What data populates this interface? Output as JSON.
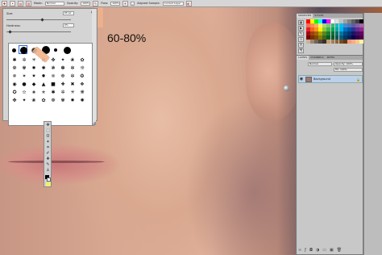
{
  "options_bar": {
    "mode_label": "Mode:",
    "mode_value": "Normal",
    "opacity_label": "Opacity:",
    "opacity_value": "100%",
    "flow_label": "Flow:",
    "flow_value": "100%",
    "sample_label": "Aligned  Sample:",
    "sample_value": "Current Layer"
  },
  "brush_picker": {
    "size_label": "Size:",
    "size_value": "65 px",
    "hardness_label": "Hardness:",
    "hardness_value": "0%",
    "size_fraction": 0.55,
    "hardness_fraction": 0.05
  },
  "annotation": {
    "text": "60-80%"
  },
  "swatches_panel": {
    "tabs": [
      "SWATCHES",
      "STYLES"
    ],
    "colors": [
      "#ff0000",
      "#ffff00",
      "#00ff00",
      "#00ffff",
      "#0000ff",
      "#ff00ff",
      "#ffffff",
      "#e0e0e0",
      "#c0c0c0",
      "#a0a0a0",
      "#808080",
      "#606060",
      "#404040",
      "#000000",
      "#f26c4f",
      "#f68e55",
      "#fbaf5c",
      "#fff467",
      "#acd372",
      "#7cc576",
      "#3bb878",
      "#1abbb4",
      "#00bff3",
      "#438ccb",
      "#5574b9",
      "#605ca8",
      "#855fa8",
      "#a763a8",
      "#ed1c24",
      "#f26522",
      "#f7941d",
      "#fff200",
      "#8dc63f",
      "#39b54a",
      "#00a651",
      "#00a99d",
      "#00aeef",
      "#0072bc",
      "#0054a6",
      "#2e3192",
      "#662d91",
      "#92278f",
      "#9e0b0f",
      "#a0410d",
      "#a3620a",
      "#aba000",
      "#598527",
      "#1a7b30",
      "#007236",
      "#00746b",
      "#0076a3",
      "#004b80",
      "#003471",
      "#1b1464",
      "#440e62",
      "#630460",
      "#790000",
      "#7b2e00",
      "#7d4900",
      "#827b00",
      "#406618",
      "#005e20",
      "#005826",
      "#005952",
      "#005b7f",
      "#003663",
      "#002157",
      "#0d004c",
      "#32004b",
      "#4b0049",
      "#c7b299",
      "#998675",
      "#736357",
      "#534741",
      "#37302d",
      "#c69c6d",
      "#a67c52",
      "#8c6239",
      "#754c24",
      "#603913",
      "#f7977a",
      "#f9ad81",
      "#fdc68a",
      "#fff79a"
    ]
  },
  "layers_panel": {
    "tabs": [
      "LAYERS",
      "CHANNELS",
      "PATHS"
    ],
    "blend_value": "Normal",
    "opacity_value": "Opacity: 100%",
    "fill_value": "Fill: 100%",
    "layer_name": "Background"
  }
}
